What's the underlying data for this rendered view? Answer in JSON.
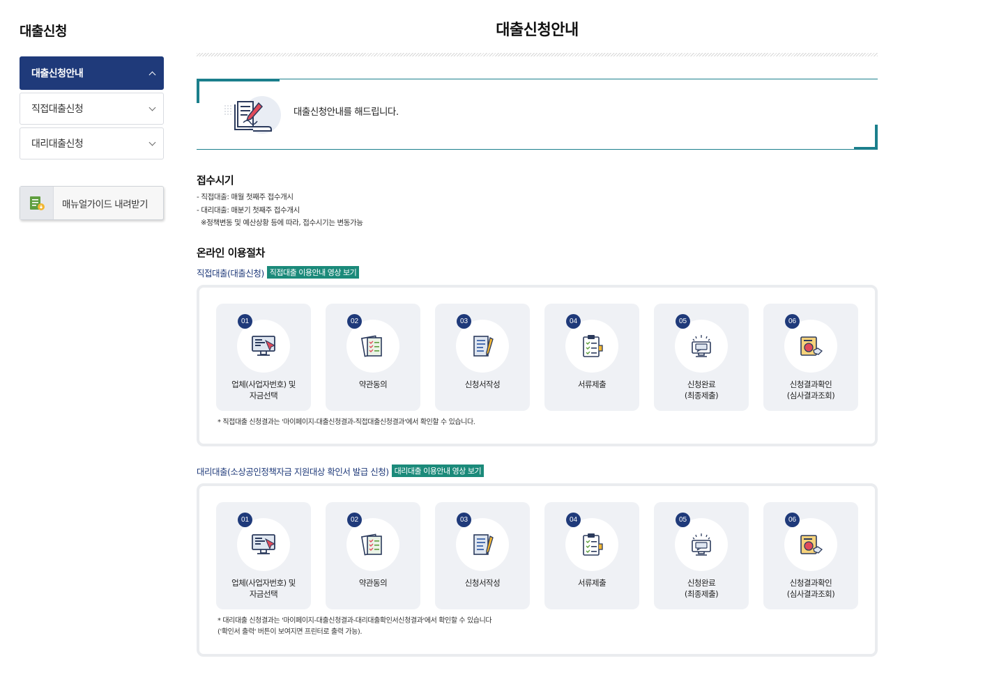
{
  "sidebar": {
    "title": "대출신청",
    "items": [
      {
        "label": "대출신청안내",
        "active": true
      },
      {
        "label": "직접대출신청",
        "active": false
      },
      {
        "label": "대리대출신청",
        "active": false
      }
    ],
    "manual_button": "매뉴얼가이드 내려받기"
  },
  "main": {
    "title": "대출신청안내",
    "intro_text": "대출신청안내를 해드립니다.",
    "reception": {
      "heading": "접수시기",
      "lines": [
        "- 직접대출: 매월 첫째주 접수개시",
        "- 대리대출: 매분기 첫째주 접수개시",
        "  ※정책변동 및 예산상황 등에 따라, 접수시기는 변동가능"
      ]
    },
    "online_heading": "온라인 이용절차",
    "direct": {
      "title": "직접대출(대출신청)",
      "video_label": "직접대출 이용안내 영상 보기",
      "note": "* 직접대출 신청결과는 '마이페이지-대출신청결과-직접대출신청결과'에서 확인할 수 있습니다."
    },
    "agency": {
      "title": "대리대출(소상공인정책자금 지원대상 확인서 발급 신청)",
      "video_label": "대리대출 이용안내 영상 보기",
      "note": "* 대리대출 신청결과는 '마이페이지-대출신청결과-대리대출확인서신청결과'에서 확인할 수 있습니다\n('확인서 출력' 버튼이 보여지면 프린터로 출력 가능)."
    },
    "steps": [
      {
        "num": "01",
        "label": "업체(사업자번호) 및\n자금선택",
        "icon": "monitor-cursor-icon"
      },
      {
        "num": "02",
        "label": "약관동의",
        "icon": "checklist-documents-icon"
      },
      {
        "num": "03",
        "label": "신청서작성",
        "icon": "document-pen-icon"
      },
      {
        "num": "04",
        "label": "서류제출",
        "icon": "clipboard-check-icon"
      },
      {
        "num": "05",
        "label": "신청완료\n(최종제출)",
        "icon": "computer-message-icon"
      },
      {
        "num": "06",
        "label": "신청결과확인\n(심사결과조회)",
        "icon": "result-handshake-icon"
      }
    ]
  },
  "colors": {
    "navy": "#1f3a7a",
    "teal": "#1b7f8c",
    "video_badge": "#1b8a7a",
    "step_bg": "#eff1f5"
  }
}
